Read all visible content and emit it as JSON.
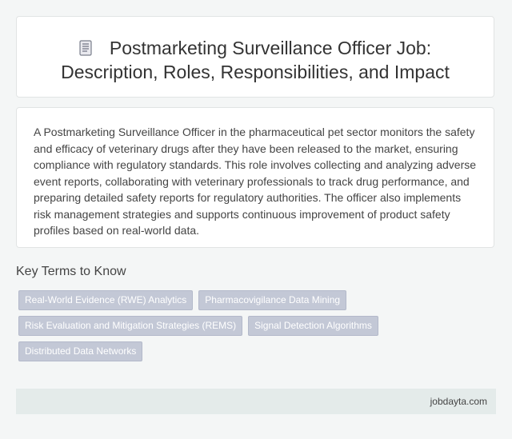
{
  "header": {
    "icon": "document-icon",
    "title_line1": "Postmarketing Surveillance Officer Job:",
    "title_line2": "Description, Roles, Responsibilities, and Impact"
  },
  "description": "A Postmarketing Surveillance Officer in the pharmaceutical pet sector monitors the safety and efficacy of veterinary drugs after they have been released to the market, ensuring compliance with regulatory standards. This role involves collecting and analyzing adverse event reports, collaborating with veterinary professionals to track drug performance, and preparing detailed safety reports for regulatory authorities. The officer also implements risk management strategies and supports continuous improvement of product safety profiles based on real-world data.",
  "key_terms": {
    "heading": "Key Terms to Know",
    "rows": [
      [
        "Real-World Evidence (RWE) Analytics",
        "Pharmacovigilance Data Mining"
      ],
      [
        "Risk Evaluation and Mitigation Strategies (REMS)",
        "Signal Detection Algorithms"
      ],
      [
        "Distributed Data Networks"
      ]
    ]
  },
  "footer": {
    "site": "jobdayta.com"
  },
  "colors": {
    "tag_bg": "#c3c8d6",
    "footer_bg": "#e4ebea",
    "page_bg": "#f4f6f6"
  }
}
